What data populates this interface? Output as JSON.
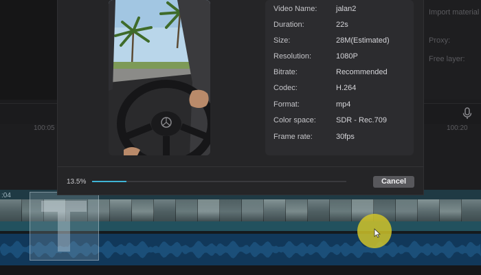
{
  "background": {
    "right_panel": {
      "items": [
        "Import material",
        "Proxy:",
        "Free layer:"
      ]
    },
    "ruler": {
      "labels": [
        "100:05",
        "100:20"
      ]
    },
    "timeline": {
      "time_marker": ":04"
    }
  },
  "dialog": {
    "info": [
      {
        "label": "Video Name:",
        "value": "jalan2"
      },
      {
        "label": "Duration:",
        "value": "22s"
      },
      {
        "label": "Size:",
        "value": "28M(Estimated)"
      },
      {
        "label": "Resolution:",
        "value": "1080P"
      },
      {
        "label": "Bitrate:",
        "value": "Recommended"
      },
      {
        "label": "Codec:",
        "value": "H.264"
      },
      {
        "label": "Format:",
        "value": "mp4"
      },
      {
        "label": "Color space:",
        "value": "SDR - Rec.709"
      },
      {
        "label": "Frame rate:",
        "value": "30fps"
      }
    ],
    "progress": {
      "text": "13.5%",
      "fraction": 0.135
    },
    "cancel_label": "Cancel"
  },
  "colors": {
    "accent": "#3fb4d6",
    "cursor_highlight": "#d6c828"
  },
  "icons": [
    "microphone-icon",
    "mouse-cursor-icon"
  ]
}
